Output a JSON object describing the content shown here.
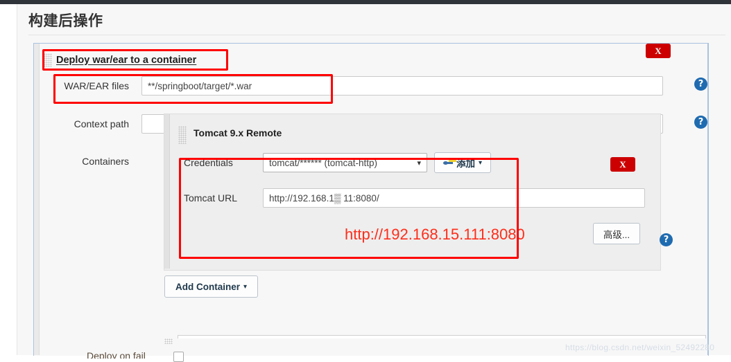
{
  "page": {
    "title": "构建后操作"
  },
  "section": {
    "heading": "Deploy war/ear to a container",
    "remove_label": "X",
    "grip_icon": "drag-grip-icon"
  },
  "fields": {
    "war_ear": {
      "label": "WAR/EAR files",
      "value": "**/springboot/target/*.war",
      "placeholder": "",
      "help_icon": "help-circle-icon"
    },
    "context_path": {
      "label": "Context path",
      "value": "",
      "placeholder": "",
      "help_icon": "help-circle-icon"
    },
    "containers": {
      "label": "Containers"
    }
  },
  "container": {
    "title": "Tomcat 9.x Remote",
    "remove_label": "X",
    "grip_icon": "drag-grip-icon",
    "credentials": {
      "label": "Credentials",
      "value": "tomcat/****** (tomcat-http)",
      "chevron_icon": "chevron-down-icon",
      "add_button": {
        "label": "添加",
        "icon": "key-icon",
        "caret_icon": "caret-down-icon"
      }
    },
    "tomcat_url": {
      "label": "Tomcat URL",
      "value": "http://192.168.1▒ 11:8080/",
      "help_icon": "help-circle-icon"
    },
    "advanced_button": {
      "label": "高级..."
    }
  },
  "annotation": {
    "url_note": "http://192.168.15.111:8080",
    "color": "#ff2d1a"
  },
  "add_container_button": {
    "label": "Add Container",
    "caret_icon": "caret-down-icon"
  },
  "bottom": {
    "partial_label": "Deploy on fail"
  },
  "watermark": {
    "text": "https://blog.csdn.net/weixin_52492280"
  },
  "colors": {
    "accent_blue": "#1f6bb0",
    "danger_red": "#cc0000",
    "annotation_red": "#ff0000",
    "panel_grey": "#eeeeee"
  }
}
